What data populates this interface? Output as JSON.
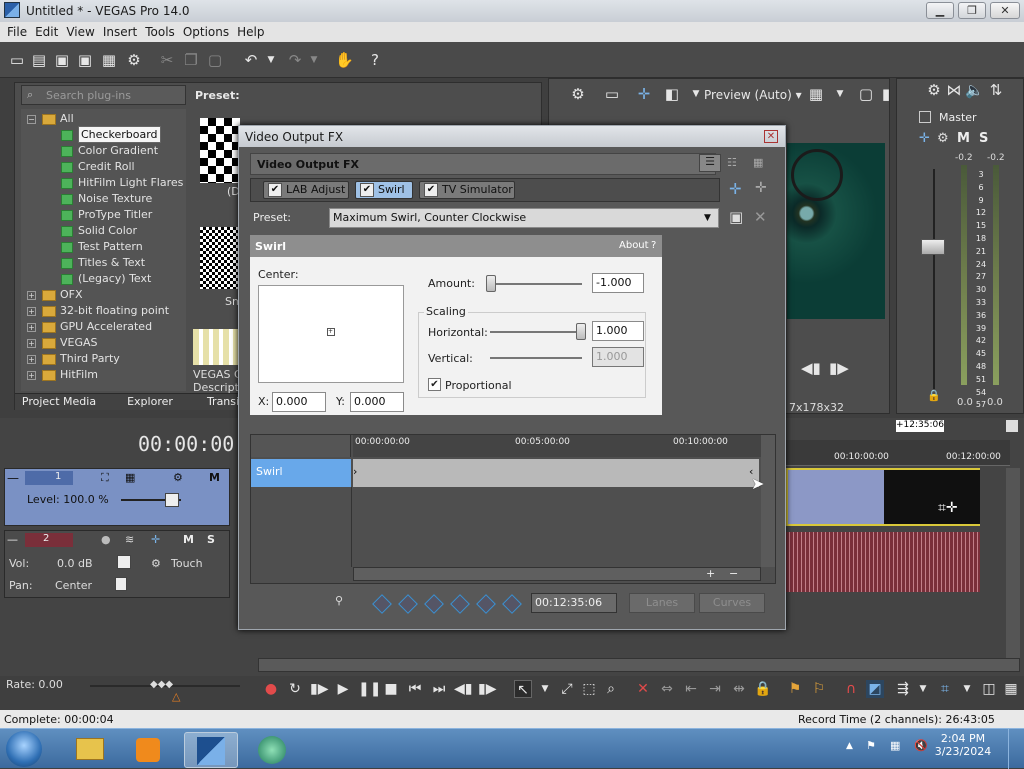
{
  "window": {
    "title": "Untitled * - VEGAS Pro 14.0",
    "min": "▁",
    "max": "❐",
    "close": "✕"
  },
  "menu": [
    "File",
    "Edit",
    "View",
    "Insert",
    "Tools",
    "Options",
    "Help"
  ],
  "preview": {
    "label": "Preview (Auto)",
    "info": "7x178x32"
  },
  "mixer": {
    "label": "Master",
    "db_left": "-0.2",
    "db_right": "-0.2",
    "scale": [
      "3",
      "6",
      "9",
      "12",
      "15",
      "18",
      "21",
      "24",
      "27",
      "30",
      "33",
      "36",
      "39",
      "42",
      "45",
      "48",
      "51",
      "54",
      "57"
    ],
    "out_left": "0.0",
    "out_right": "0.0"
  },
  "plugins": {
    "search_placeholder": "Search plug-ins",
    "preset_label": "Preset:",
    "tree": [
      {
        "label": "All",
        "type": "folder",
        "expanded": true
      },
      {
        "label": "Checkerboard",
        "type": "plugin",
        "selected": true
      },
      {
        "label": "Color Gradient",
        "type": "plugin"
      },
      {
        "label": "Credit Roll",
        "type": "plugin"
      },
      {
        "label": "HitFilm Light Flares",
        "type": "plugin"
      },
      {
        "label": "Noise Texture",
        "type": "plugin"
      },
      {
        "label": "ProType Titler",
        "type": "plugin"
      },
      {
        "label": "Solid Color",
        "type": "plugin"
      },
      {
        "label": "Test Pattern",
        "type": "plugin"
      },
      {
        "label": "Titles & Text",
        "type": "plugin"
      },
      {
        "label": "(Legacy) Text",
        "type": "plugin"
      },
      {
        "label": "OFX",
        "type": "folder"
      },
      {
        "label": "32-bit floating point",
        "type": "folder"
      },
      {
        "label": "GPU Accelerated",
        "type": "folder"
      },
      {
        "label": "VEGAS",
        "type": "folder"
      },
      {
        "label": "Third Party",
        "type": "folder"
      },
      {
        "label": "HitFilm",
        "type": "folder"
      }
    ],
    "thumb_labels": [
      "(D",
      "Sm",
      "VEGAS Ch",
      "Descriptio"
    ],
    "tabs": [
      "Project Media",
      "Explorer",
      "Transi"
    ]
  },
  "dialog": {
    "title": "Video Output FX",
    "header": "Video Output FX",
    "chain": [
      "LAB Adjust",
      "Swirl",
      "TV Simulator"
    ],
    "preset_label": "Preset:",
    "preset_value": "Maximum Swirl, Counter Clockwise",
    "panel_title": "Swirl",
    "about": "About",
    "help": "?",
    "center_label": "Center:",
    "x_label": "X:",
    "x_value": "0.000",
    "y_label": "Y:",
    "y_value": "0.000",
    "amount_label": "Amount:",
    "amount_value": "-1.000",
    "amount_level": 0.0,
    "scaling_label": "Scaling",
    "horizontal_label": "Horizontal:",
    "horizontal_value": "1.000",
    "horizontal_level": 1.0,
    "vertical_label": "Vertical:",
    "vertical_value": "1.000",
    "proportional_label": "Proportional",
    "proportional_checked": true,
    "timeline_ticks": [
      "00:00:00:00",
      "00:05:00:00",
      "00:10:00:00"
    ],
    "track_label": "Swirl",
    "time_value": "00:12:35:06",
    "lanes_label": "Lanes",
    "curves_label": "Curves"
  },
  "timeline": {
    "timecode": "00:00:00:0",
    "ticks": [
      "00:10:00:00",
      "00:12:00:00"
    ],
    "marker": "+12:35:06",
    "video_track": {
      "number": "1",
      "level": "Level: 100.0 %"
    },
    "audio_track": {
      "number": "2",
      "vol_label": "Vol:",
      "vol": "0.0 dB",
      "pan_label": "Pan:",
      "pan": "Center",
      "touch": "Touch"
    },
    "rate": "Rate: 0.00"
  },
  "status": {
    "complete": "Complete: 00:00:04",
    "record_time": "Record Time (2 channels): 26:43:05"
  },
  "taskbar": {
    "time": "2:04 PM",
    "date": "3/23/2024"
  },
  "colors": {
    "accent": "#6fa8e8",
    "clip_video": "#8c98c6",
    "clip_audio": "#7a2f3a"
  }
}
